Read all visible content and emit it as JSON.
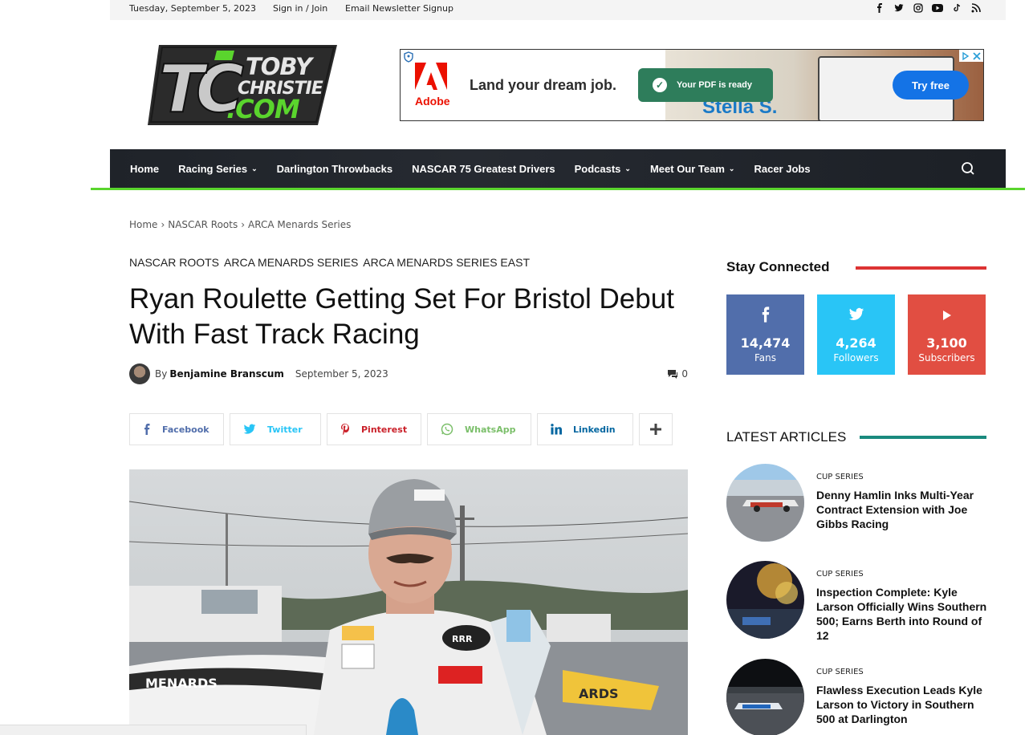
{
  "topbar": {
    "date": "Tuesday, September 5, 2023",
    "signin": "Sign in / Join",
    "newsletter": "Email Newsletter Signup",
    "social_icons": [
      "facebook-icon",
      "twitter-icon",
      "instagram-icon",
      "youtube-icon",
      "tiktok-icon",
      "rss-icon"
    ]
  },
  "logo": {
    "line1": "TOBY",
    "line2": "CHRISTIE",
    "line3": ".COM",
    "mark": "TC"
  },
  "ad": {
    "brand": "Adobe",
    "headline": "Land your dream job.",
    "toast": "Your PDF is ready",
    "resume_name": "Stella S.",
    "cta": "Try free"
  },
  "nav": {
    "items": [
      {
        "label": "Home",
        "dropdown": false
      },
      {
        "label": "Racing Series",
        "dropdown": true
      },
      {
        "label": "Darlington Throwbacks",
        "dropdown": false
      },
      {
        "label": "NASCAR 75 Greatest Drivers",
        "dropdown": false
      },
      {
        "label": "Podcasts",
        "dropdown": true
      },
      {
        "label": "Meet Our Team",
        "dropdown": true
      },
      {
        "label": "Racer Jobs",
        "dropdown": false
      }
    ],
    "accent": "#5ad52d"
  },
  "breadcrumb": [
    "Home",
    "NASCAR Roots",
    "ARCA Menards Series"
  ],
  "article": {
    "categories": [
      "NASCAR Roots",
      "ARCA Menards Series",
      "ARCA Menards Series East"
    ],
    "title": "Ryan Roulette Getting Set For Bristol Debut With Fast Track Racing",
    "by": "By",
    "author": "Benjamine Branscum",
    "date": "September 5, 2023",
    "comments": "0"
  },
  "share": [
    {
      "label": "Facebook",
      "icon": "facebook-icon",
      "color": "#516eab"
    },
    {
      "label": "Twitter",
      "icon": "twitter-icon",
      "color": "#29c5f6"
    },
    {
      "label": "Pinterest",
      "icon": "pinterest-icon",
      "color": "#ca212a"
    },
    {
      "label": "WhatsApp",
      "icon": "whatsapp-icon",
      "color": "#7bbf6a"
    },
    {
      "label": "Linkedin",
      "icon": "linkedin-icon",
      "color": "#0266a0"
    }
  ],
  "sidebar": {
    "stay_connected": "Stay Connected",
    "stay_line_color": "#dd3333",
    "social": [
      {
        "network": "facebook",
        "count": "14,474",
        "label": "Fans",
        "color": "#516eab"
      },
      {
        "network": "twitter",
        "count": "4,264",
        "label": "Followers",
        "color": "#29c5f6"
      },
      {
        "network": "youtube",
        "count": "3,100",
        "label": "Subscribers",
        "color": "#e14e42"
      }
    ],
    "latest": "LATEST ARTICLES",
    "latest_line_color": "#1a8a7e",
    "articles": [
      {
        "category": "CUP SERIES",
        "title": "Denny Hamlin Inks Multi-Year Contract Extension with Joe Gibbs Racing"
      },
      {
        "category": "CUP SERIES",
        "title": "Inspection Complete: Kyle Larson Officially Wins Southern 500; Earns Berth into Round of 12"
      },
      {
        "category": "CUP SERIES",
        "title": "Flawless Execution Leads Kyle Larson to Victory in Southern 500 at Darlington"
      }
    ]
  }
}
